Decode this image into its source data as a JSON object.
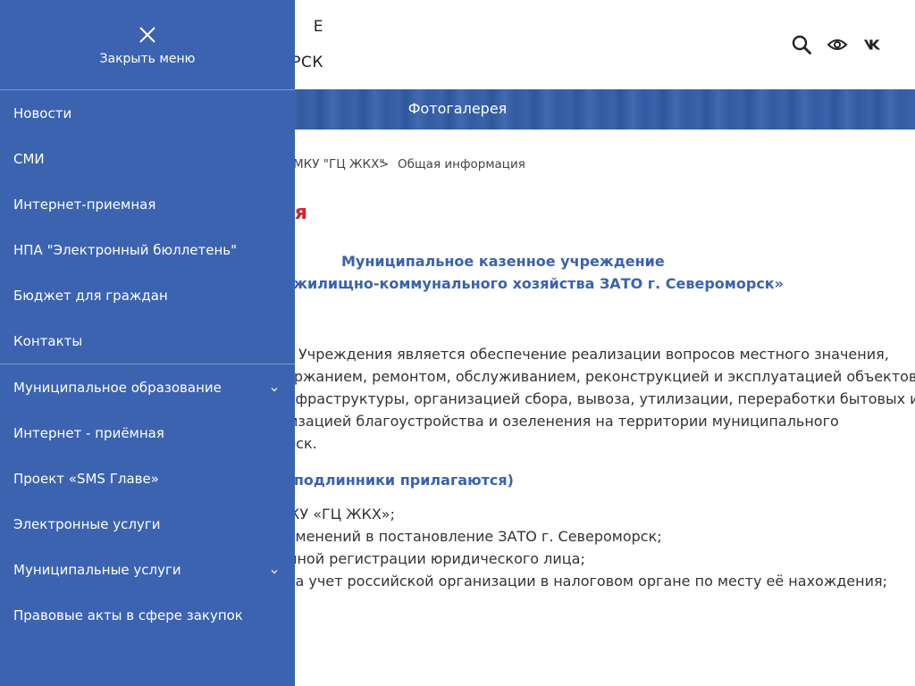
{
  "header": {
    "title_line1": "Е",
    "title_line2": "РСК",
    "icons": [
      "search-icon",
      "eye-icon",
      "vk-icon"
    ]
  },
  "banner": {
    "title": "Фотогалерея"
  },
  "breadcrumb": {
    "items": [
      "МКУ \"ГЦ ЖКХ\"",
      "Общая информация"
    ],
    "separator": ">"
  },
  "page": {
    "title": "я",
    "org_line1": "Муниципальное казенное учреждение",
    "org_line2": "ентр жилищно-коммунального хозяйства ЗАТО г. Североморск»",
    "paragraph": [
      "Учреждения является обеспечение реализации вопросов местного значения,",
      "ержанием, ремонтом, обслуживанием, реконструкцией и эксплуатацией объектов",
      "нфраструктуры, организацией сбора, вывоза, утилизации, переработки бытовых и",
      "изацией благоустройства и озеленения на территории муниципального",
      "рск."
    ],
    "docs_heading": "е подлинники прилагаются)",
    "docs": [
      "КУ «ГЦ ЖКХ»;",
      "зменений в постановление ЗАТО г. Североморск;",
      "нной регистрации юридического лица;",
      "на учет российской организации в налоговом органе по месту её нахождения;"
    ]
  },
  "menu": {
    "close_label": "Закрыть меню",
    "items": [
      {
        "label": "Новости"
      },
      {
        "label": "СМИ"
      },
      {
        "label": "Интернет-приемная"
      },
      {
        "label": "НПА \"Электронный бюллетень\""
      },
      {
        "label": "Бюджет для граждан"
      },
      {
        "label": "Контакты"
      },
      {
        "label": "Муниципальное образование"
      },
      {
        "label": "Интернет - приёмная"
      },
      {
        "label": "Проект «SMS Главе»"
      },
      {
        "label": "Электронные услуги"
      },
      {
        "label": "Муниципальные услуги"
      },
      {
        "label": "Правовые акты в сфере закупок"
      }
    ]
  },
  "colors": {
    "menu_bg": "#3c63b0",
    "accent_blue": "#3a62ad",
    "title_red": "#d0242b"
  }
}
